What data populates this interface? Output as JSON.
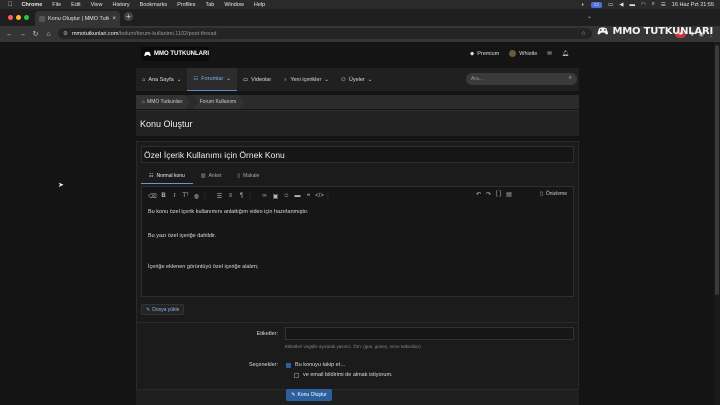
{
  "menubar": {
    "app": "Chrome",
    "items": [
      "File",
      "Edit",
      "View",
      "History",
      "Bookmarks",
      "Profiles",
      "Tab",
      "Window",
      "Help"
    ],
    "clock": "16 Haz Pzt 21:55"
  },
  "tab": {
    "title": "Konu Oluştur | MMO Tutkunları",
    "close": "×"
  },
  "newtab": "+",
  "address": {
    "host": "mmotutkunlari.com",
    "path": "/bolum/forum-kullanimi.1102/post-thread"
  },
  "corner_logo_text": "MMO TUTKUNLARI",
  "site": {
    "logo_text": "MMO TUTKUNLARI",
    "user_nav": {
      "premium": "Premium",
      "whistle": "Whistle"
    },
    "nav": [
      {
        "label": "Ana Sayfa",
        "icon": "home-icon"
      },
      {
        "label": "Forumlar",
        "icon": "comments-icon",
        "active": true
      },
      {
        "label": "Videolar",
        "icon": "video-icon"
      },
      {
        "label": "Yeni içerikler",
        "icon": "bulb-icon"
      },
      {
        "label": "Üyeler",
        "icon": "users-icon"
      }
    ],
    "search_placeholder": "Ara...",
    "breadcrumbs": [
      "MMO Tutkunları",
      "Forum Kullanımı"
    ],
    "page_title": "Konu Oluştur"
  },
  "form": {
    "title_value": "Özel İçerik Kullanımı için Örnek Konu",
    "type_tabs": [
      "Normal konu",
      "Anket",
      "Makale"
    ],
    "preview_label": "Önizleme",
    "body_lines": [
      "Bu konu özel içerik kullanımını anlattığım video için hazırlanmıştır.",
      "Bu yazı özel içeriğe dahildir.",
      "İçeriğe eklenen görüntüyü özel içeriğe alalım;"
    ],
    "attach_label": "Dosya yükle",
    "tags_label": "Etiketler:",
    "tags_hint": "Etiketleri virgülle ayırarak yazınız. Örn: (gün, güneş, mmo tutkunları)",
    "options_label": "Seçenekler:",
    "option_watch": "Bu konuyu takip et…",
    "option_email": "ve email bildirimi de almak istiyorum.",
    "submit_label": "Konu Oluştur"
  }
}
